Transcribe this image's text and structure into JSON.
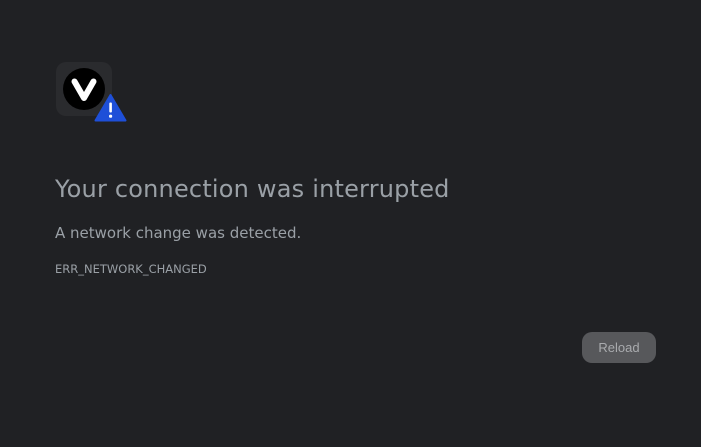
{
  "error": {
    "title": "Your connection was interrupted",
    "description": "A network change was detected.",
    "code": "ERR_NETWORK_CHANGED"
  },
  "icons": {
    "browser_logo": "vivaldi-logo-icon",
    "warning": "warning-triangle-icon"
  },
  "actions": {
    "reload_label": "Reload"
  },
  "colors": {
    "background": "#202124",
    "text": "#9aa0a6",
    "warning_blue": "#1e4fd8",
    "button_bg": "#57585b"
  }
}
